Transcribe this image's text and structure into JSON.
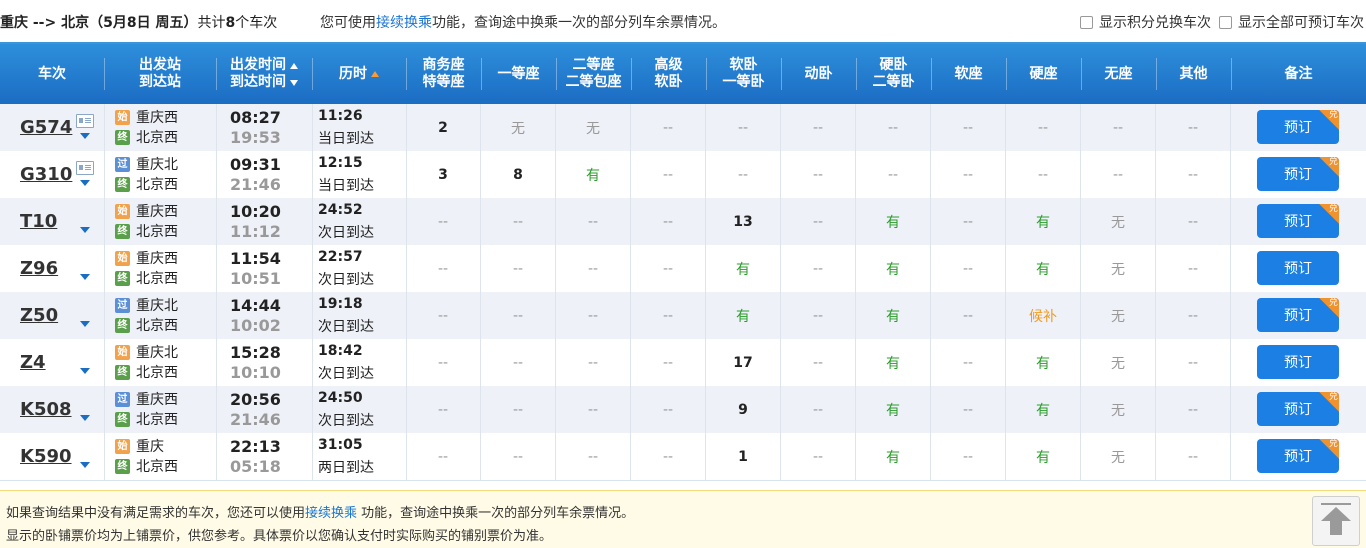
{
  "topbar": {
    "route": "重庆 --> 北京（5月8日  周五）",
    "count_pre": "共计",
    "count": "8",
    "count_post": "个车次",
    "hint_pre": "您可使用",
    "hint_link": "接续换乘",
    "hint_post": "功能，查询途中换乘一次的部分列车余票情况。",
    "check_points": "显示积分兑换车次",
    "check_all": "显示全部可预订车次"
  },
  "header": {
    "train": "车次",
    "from": "出发站",
    "to": "到达站",
    "depart": "出发时间",
    "arrive": "到达时间",
    "duration": "历时",
    "business_1": "商务座",
    "business_2": "特等座",
    "first": "一等座",
    "second_1": "二等座",
    "second_2": "二等包座",
    "adv_1": "高级",
    "adv_2": "软卧",
    "soft_1": "软卧",
    "soft_2": "一等卧",
    "dongwo": "动卧",
    "hard_1": "硬卧",
    "hard_2": "二等卧",
    "softseat": "软座",
    "hardseat": "硬座",
    "noseat": "无座",
    "other": "其他",
    "remark": "备注"
  },
  "rows": [
    {
      "code": "G574",
      "card": true,
      "from": "重庆西",
      "from_type": "始",
      "to": "北京西",
      "to_type": "终",
      "dep": "08:27",
      "arr": "19:53",
      "dur": "11:26",
      "day": "当日到达",
      "seats": [
        "2",
        "无",
        "无",
        "--",
        "--",
        "--",
        "--",
        "--",
        "--",
        "--",
        "--"
      ],
      "book": "预订",
      "redeem": "兑"
    },
    {
      "code": "G310",
      "card": true,
      "from": "重庆北",
      "from_type": "过",
      "to": "北京西",
      "to_type": "终",
      "dep": "09:31",
      "arr": "21:46",
      "dur": "12:15",
      "day": "当日到达",
      "seats": [
        "3",
        "8",
        "有",
        "--",
        "--",
        "--",
        "--",
        "--",
        "--",
        "--",
        "--"
      ],
      "book": "预订",
      "redeem": "兑"
    },
    {
      "code": "T10",
      "card": false,
      "from": "重庆西",
      "from_type": "始",
      "to": "北京西",
      "to_type": "终",
      "dep": "10:20",
      "arr": "11:12",
      "dur": "24:52",
      "day": "次日到达",
      "seats": [
        "--",
        "--",
        "--",
        "--",
        "13",
        "--",
        "有",
        "--",
        "有",
        "无",
        "--"
      ],
      "book": "预订",
      "redeem": "兑"
    },
    {
      "code": "Z96",
      "card": false,
      "from": "重庆西",
      "from_type": "始",
      "to": "北京西",
      "to_type": "终",
      "dep": "11:54",
      "arr": "10:51",
      "dur": "22:57",
      "day": "次日到达",
      "seats": [
        "--",
        "--",
        "--",
        "--",
        "有",
        "--",
        "有",
        "--",
        "有",
        "无",
        "--"
      ],
      "book": "预订",
      "redeem": ""
    },
    {
      "code": "Z50",
      "card": false,
      "from": "重庆北",
      "from_type": "过",
      "to": "北京西",
      "to_type": "终",
      "dep": "14:44",
      "arr": "10:02",
      "dur": "19:18",
      "day": "次日到达",
      "seats": [
        "--",
        "--",
        "--",
        "--",
        "有",
        "--",
        "有",
        "--",
        "候补",
        "无",
        "--"
      ],
      "book": "预订",
      "redeem": "兑"
    },
    {
      "code": "Z4",
      "card": false,
      "from": "重庆北",
      "from_type": "始",
      "to": "北京西",
      "to_type": "终",
      "dep": "15:28",
      "arr": "10:10",
      "dur": "18:42",
      "day": "次日到达",
      "seats": [
        "--",
        "--",
        "--",
        "--",
        "17",
        "--",
        "有",
        "--",
        "有",
        "无",
        "--"
      ],
      "book": "预订",
      "redeem": ""
    },
    {
      "code": "K508",
      "card": false,
      "from": "重庆西",
      "from_type": "过",
      "to": "北京西",
      "to_type": "终",
      "dep": "20:56",
      "arr": "21:46",
      "dur": "24:50",
      "day": "次日到达",
      "seats": [
        "--",
        "--",
        "--",
        "--",
        "9",
        "--",
        "有",
        "--",
        "有",
        "无",
        "--"
      ],
      "book": "预订",
      "redeem": "兑"
    },
    {
      "code": "K590",
      "card": false,
      "from": "重庆",
      "from_type": "始",
      "to": "北京西",
      "to_type": "终",
      "dep": "22:13",
      "arr": "05:18",
      "dur": "31:05",
      "day": "两日到达",
      "seats": [
        "--",
        "--",
        "--",
        "--",
        "1",
        "--",
        "有",
        "--",
        "有",
        "无",
        "--"
      ],
      "book": "预订",
      "redeem": "兑"
    }
  ],
  "footer": {
    "line1_pre": "如果查询结果中没有满足需求的车次，您还可以使用",
    "line1_link": "接续换乘",
    "line1_post": " 功能，查询途中换乘一次的部分列车余票情况。",
    "line2": "显示的卧铺票价均为上铺票价，供您参考。具体票价以您确认支付时实际购买的铺别票价为准。"
  },
  "colors": {
    "header": "#1b6cc3",
    "available": "#2a9d2a",
    "waitlist": "#f39a1e",
    "book_button": "#1b7fe3",
    "redeem_corner": "#f0922e"
  }
}
